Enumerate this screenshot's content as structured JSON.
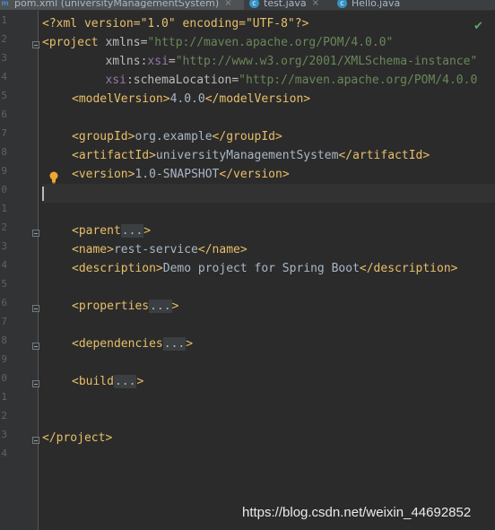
{
  "tabs": [
    {
      "label": "pom.xml (universityManagementSystem)",
      "active": true,
      "icon": "maven-icon",
      "close": "×"
    },
    {
      "label": "test.java",
      "active": false,
      "icon": "java-class-icon",
      "close": "×"
    },
    {
      "label": "Hello.java",
      "active": false,
      "icon": "java-class-icon",
      "close": ""
    }
  ],
  "line_numbers": [
    "1",
    "2",
    "3",
    "4",
    "5",
    "6",
    "7",
    "8",
    "9",
    "0",
    "1",
    "2",
    "3",
    "4",
    "5",
    "6",
    "7",
    "8",
    "9",
    "0",
    "1",
    "2",
    "3",
    "4"
  ],
  "code": {
    "l1_decl": "<?xml version=\"1.0\" encoding=\"UTF-8\"?>",
    "l2_open": "<project",
    "l2_attr": " xmlns",
    "l2_eq": "=",
    "l2_val": "\"http://maven.apache.org/POM/4.0.0\"",
    "l3_indent": "         ",
    "l3_ns": "xmlns:",
    "l3_attr": "xsi",
    "l3_eq": "=",
    "l3_val": "\"http://www.w3.org/2001/XMLSchema-instance\"",
    "l4_indent": "         ",
    "l4_ns": "xsi",
    "l4_attr": ":schemaLocation",
    "l4_eq": "=",
    "l4_val": "\"http://maven.apache.org/POM/4.0.0",
    "l5_open": "<modelVersion>",
    "l5_text": "4.0.0",
    "l5_close": "</modelVersion>",
    "l7_open": "<groupId>",
    "l7_text": "org.example",
    "l7_close": "</groupId>",
    "l8_open": "<artifactId>",
    "l8_text": "universityManagementSystem",
    "l8_close": "</artifactId>",
    "l9_open": "<version>",
    "l9_text": "1.0-SNAPSHOT",
    "l9_close": "</version>",
    "l12_open": "<parent",
    "l12_dots": "...",
    "l12_close": ">",
    "l13_open": "<name>",
    "l13_text": "rest-service",
    "l13_close": "</name>",
    "l14_open": "<description>",
    "l14_text": "Demo project for Spring Boot",
    "l14_close": "</description>",
    "l16_open": "<properties",
    "l16_dots": "...",
    "l16_close": ">",
    "l18_open": "<dependencies",
    "l18_dots": "...",
    "l18_close": ">",
    "l20_open": "<build",
    "l20_dots": "...",
    "l20_close": ">",
    "l24_close": "</project>"
  },
  "status": {
    "check": "✔"
  },
  "watermark": "https://blog.csdn.net/weixin_44692852",
  "colors": {
    "background": "#2b2b2b",
    "tag": "#e8bf6a",
    "string": "#6a8759",
    "namespace": "#9876aa"
  }
}
